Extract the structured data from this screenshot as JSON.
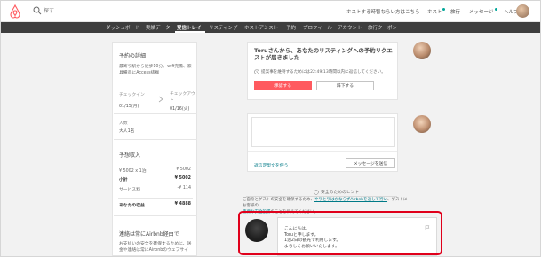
{
  "header": {
    "search_placeholder": "探す",
    "links": [
      "ホストする時智ならい方はこちら",
      "ホスト",
      "旅行",
      "メッセージ",
      "ヘルプ"
    ]
  },
  "nav": {
    "items": [
      "ダッシュボード",
      "実績データ",
      "受信トレイ",
      "リスティング",
      "ホストアシスト",
      "予約",
      "プロフィール",
      "アカウント",
      "旅行クーポン"
    ],
    "active": "受信トレイ"
  },
  "reservation": {
    "title": "予約の詳細",
    "description": "最寄り駅から徒歩10分、wifi完備、家具備品にAccess抜群",
    "checkin_label": "チェックイン",
    "checkin_date": "01/15(月)",
    "checkout_label": "チェックアウト",
    "checkout_date": "01/16(火)",
    "guests_label": "人数",
    "guests_value": "大人1名"
  },
  "earnings": {
    "title": "予想収入",
    "rows": [
      {
        "label": "¥ 5002 x 1泊",
        "value": "¥ 5002"
      },
      {
        "label": "小計",
        "value": "¥ 5002"
      },
      {
        "label": "サービス料",
        "value": "-¥ 114"
      },
      {
        "label": "あなたの収益",
        "value": "¥ 4888"
      }
    ]
  },
  "contact_note": {
    "title": "連絡は常にAirbnb経由で",
    "body": "お支払いの安全を確保するために、送金や連絡は常にAirbnbのウェブサイ"
  },
  "request": {
    "title": "Toruさんから、あなたのリスティングへの予約リクエストが届きました",
    "note": "提案事を維持するためには22:49:13時間以内に返信してください。",
    "approve_label": "承認する",
    "decline_label": "辞下する"
  },
  "message_box": {
    "link_label": "返信定型文を使う",
    "send_label": "メッセージを送信"
  },
  "safety_hint": {
    "title": "安全のためのヒント",
    "body_prefix": "ご自身とゲストの安全を確保するため、",
    "link1": "やりとりはかならずAirbnbを通して行い",
    "body_mid": "、ゲストにお客様の",
    "link2": "重要な安全設備",
    "body_suffix": "のことを伝えてください。"
  },
  "guest_message": {
    "text": "こんにちは。\nToruと申します。\n1泊2日の観光で利用します。\nよろしくお願いいたします。"
  },
  "colors": {
    "primary": "#ff5a5f",
    "nav_bg": "#3e3e3e",
    "link": "#007a87",
    "highlight": "#e0001b"
  }
}
